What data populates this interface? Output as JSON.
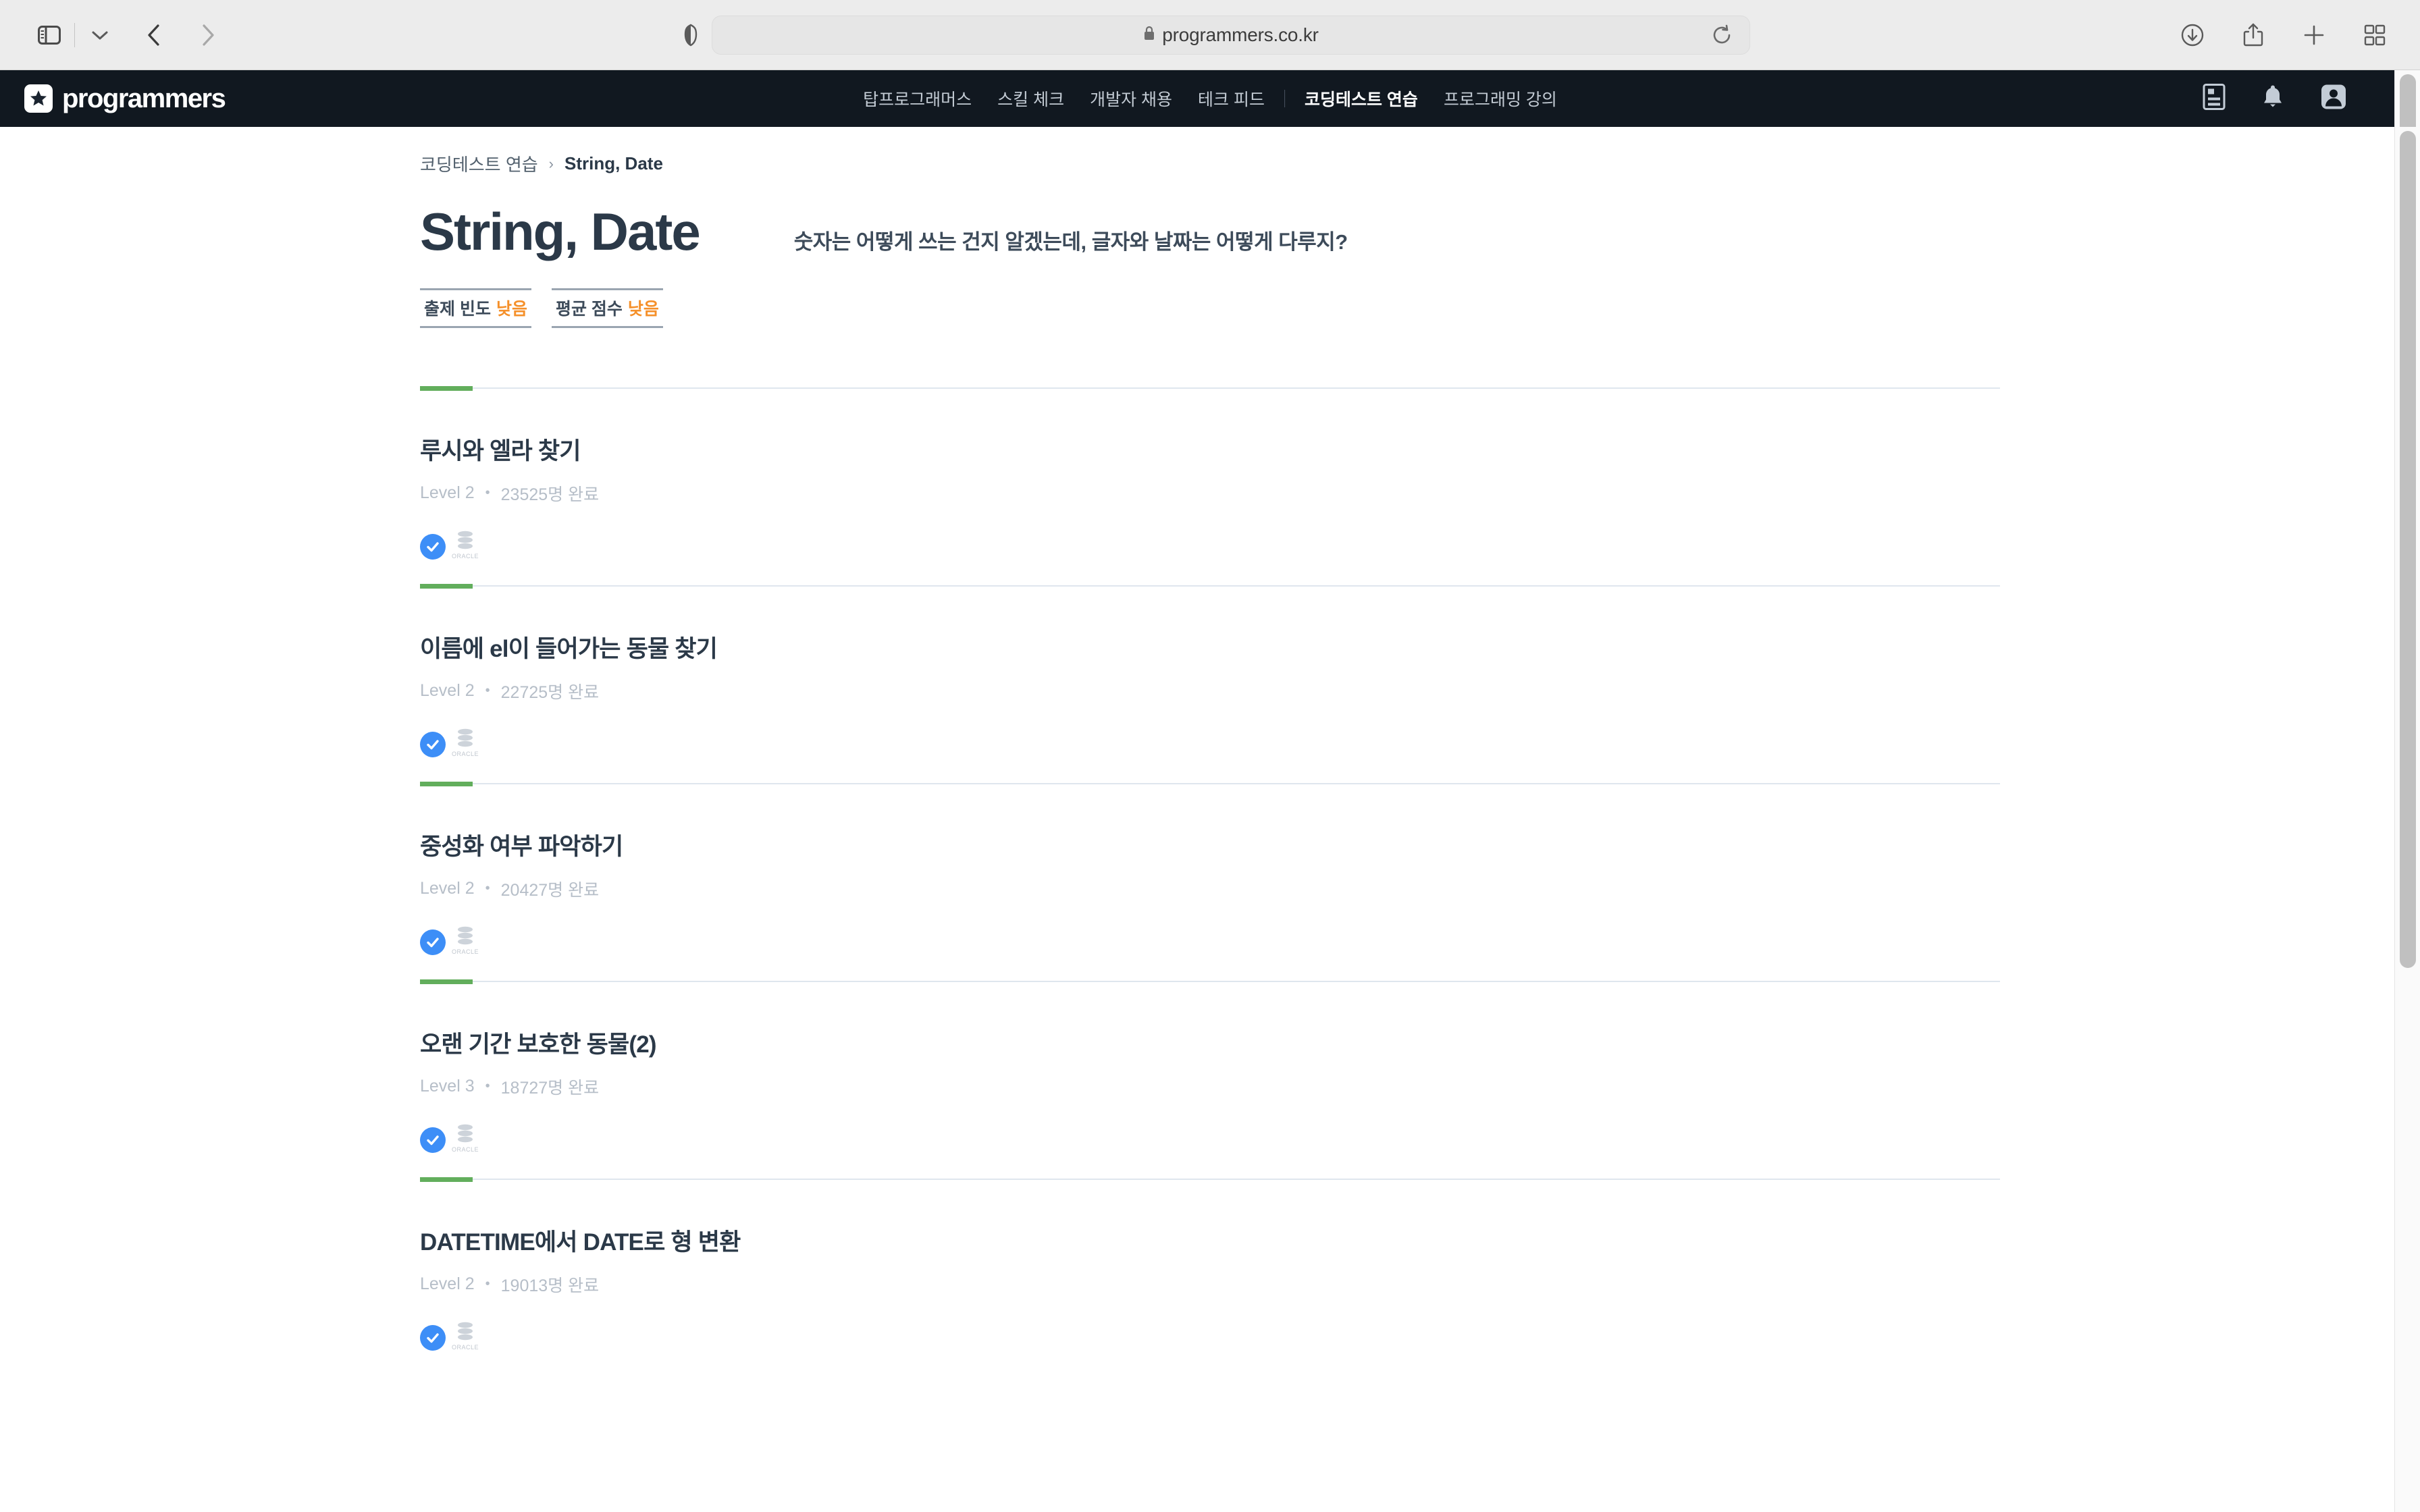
{
  "browser": {
    "url": "programmers.co.kr",
    "icons": {
      "sidebar": "sidebar-toggle-icon",
      "tab_menu": "chevron-down-icon",
      "back": "back-arrow-icon",
      "forward": "forward-arrow-icon",
      "shield": "privacy-shield-icon",
      "lock": "lock-icon",
      "reload": "reload-icon",
      "downloads": "downloads-icon",
      "share": "share-icon",
      "new_tab": "plus-icon",
      "tab_overview": "tab-overview-icon"
    }
  },
  "site_header": {
    "logo_text": "programmers",
    "nav": [
      {
        "label": "탑프로그래머스",
        "active": false
      },
      {
        "label": "스킬 체크",
        "active": false
      },
      {
        "label": "개발자 채용",
        "active": false
      },
      {
        "label": "테크 피드",
        "active": false
      },
      {
        "label": "코딩테스트 연습",
        "active": true
      },
      {
        "label": "프로그래밍 강의",
        "active": false
      }
    ],
    "icons": [
      {
        "name": "resume-icon"
      },
      {
        "name": "bell-icon"
      },
      {
        "name": "profile-avatar-icon"
      }
    ]
  },
  "breadcrumb": {
    "parent": "코딩테스트 연습",
    "separator": "›",
    "current": "String, Date"
  },
  "page": {
    "title": "String, Date",
    "description": "숫자는 어떻게 쓰는 건지 알겠는데, 글자와 날짜는 어떻게 다루지?",
    "badges": [
      {
        "label": "출제 빈도",
        "value": "낮음"
      },
      {
        "label": "평균 점수",
        "value": "낮음"
      }
    ]
  },
  "problems": [
    {
      "title": "루시와 엘라 찾기",
      "level": "Level 2",
      "dot": "•",
      "completed": "23525명 완료",
      "solved_icon": "check-circle-icon",
      "db_icon": "oracle-database-icon",
      "db_label": "ORACLE"
    },
    {
      "title": "이름에 el이 들어가는 동물 찾기",
      "level": "Level 2",
      "dot": "•",
      "completed": "22725명 완료",
      "solved_icon": "check-circle-icon",
      "db_icon": "oracle-database-icon",
      "db_label": "ORACLE"
    },
    {
      "title": "중성화 여부 파악하기",
      "level": "Level 2",
      "dot": "•",
      "completed": "20427명 완료",
      "solved_icon": "check-circle-icon",
      "db_icon": "oracle-database-icon",
      "db_label": "ORACLE"
    },
    {
      "title": "오랜 기간 보호한 동물(2)",
      "level": "Level 3",
      "dot": "•",
      "completed": "18727명 완료",
      "solved_icon": "check-circle-icon",
      "db_icon": "oracle-database-icon",
      "db_label": "ORACLE"
    },
    {
      "title": "DATETIME에서 DATE로 형 변환",
      "level": "Level 2",
      "dot": "•",
      "completed": "19013명 완료",
      "solved_icon": "check-circle-icon",
      "db_icon": "oracle-database-icon",
      "db_label": "ORACLE"
    }
  ],
  "colors": {
    "header_bg": "#111820",
    "accent_green": "#62ae5c",
    "accent_orange": "#f5902a",
    "check_blue": "#3d8ef7",
    "title_navy": "#2b3948"
  }
}
